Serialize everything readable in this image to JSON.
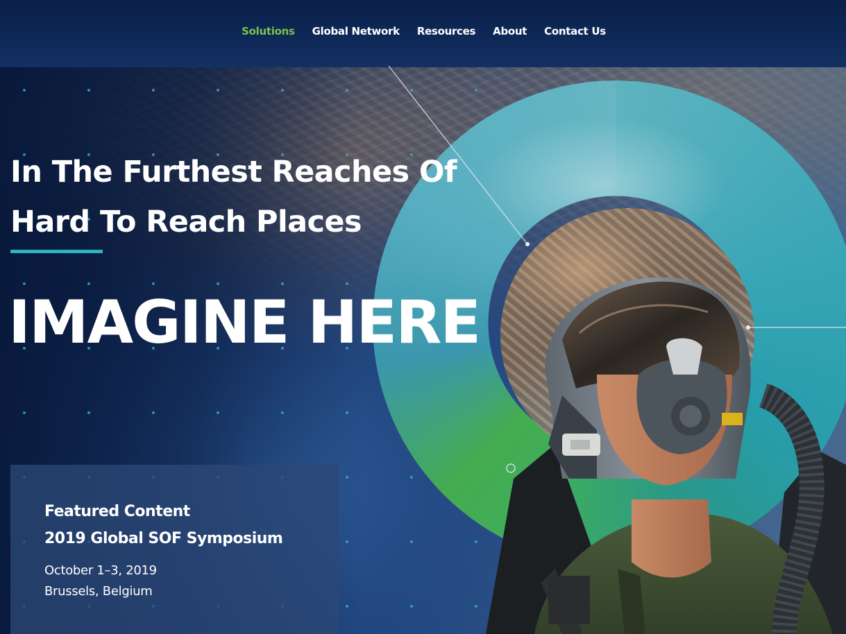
{
  "nav": {
    "items": [
      {
        "label": "Solutions",
        "active": true
      },
      {
        "label": "Global Network",
        "active": false
      },
      {
        "label": "Resources",
        "active": false
      },
      {
        "label": "About",
        "active": false
      },
      {
        "label": "Contact Us",
        "active": false
      }
    ]
  },
  "hero": {
    "tagline_line1": "In The Furthest Reaches Of",
    "tagline_line2": "Hard To Reach Places",
    "headline": "IMAGINE HERE"
  },
  "featured": {
    "kicker": "Featured Content",
    "title": "2019 Global SOF Symposium",
    "date": "October 1–3, 2019",
    "location": "Brussels, Belgium"
  },
  "colors": {
    "nav_active": "#7bc24d",
    "accent_line": "#2eb3c2",
    "ring_teal": "#3aa9b8",
    "ring_green": "#47b04d",
    "background_navy": "#0c2350"
  },
  "icons": [
    "fighter-pilot-photo",
    "ring-graphic"
  ]
}
